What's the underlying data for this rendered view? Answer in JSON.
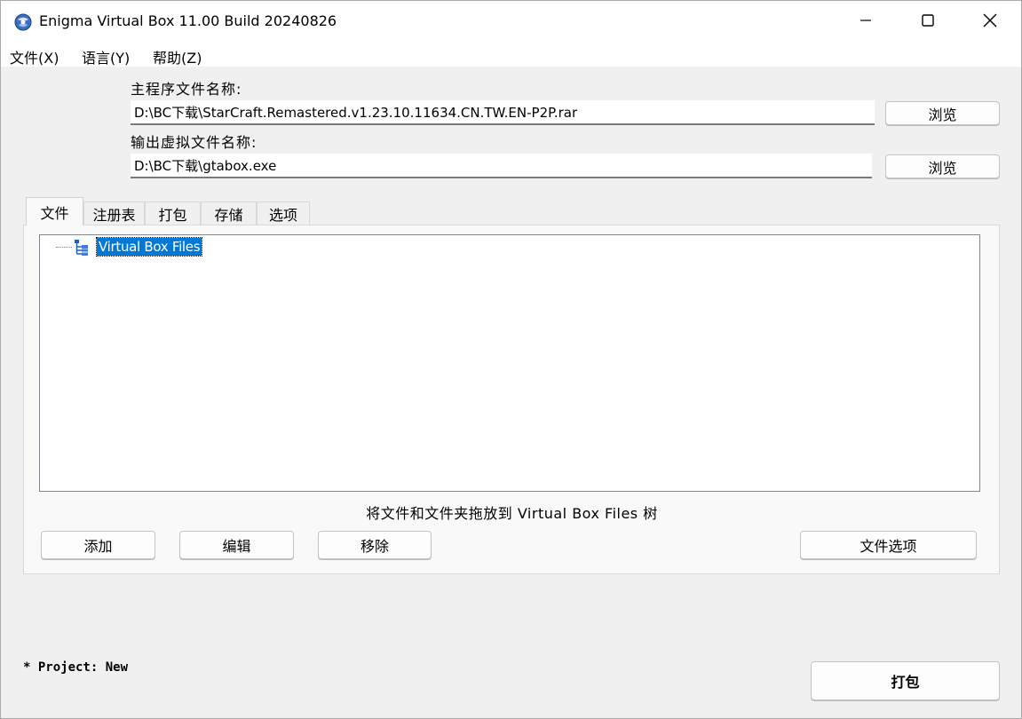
{
  "window": {
    "title": "Enigma Virtual Box 11.00 Build 20240826",
    "controls": [
      "minimize-icon",
      "maximize-icon",
      "close-icon"
    ]
  },
  "menu": {
    "items": [
      "文件(X)",
      "语言(Y)",
      "帮助(Z)"
    ]
  },
  "main_file": {
    "label": "主程序文件名称:",
    "value": "D:\\BC下载\\StarCraft.Remastered.v1.23.10.11634.CN.TW.EN-P2P.rar",
    "browse": "浏览"
  },
  "output_file": {
    "label": "输出虚拟文件名称:",
    "value": "D:\\BC下载\\gtabox.exe",
    "browse": "浏览"
  },
  "tabs": {
    "items": [
      "文件",
      "注册表",
      "打包",
      "存储",
      "选项"
    ],
    "active": "文件"
  },
  "tree": {
    "root_label": "Virtual Box Files",
    "root_icon": "tree-structure-icon"
  },
  "hint": "将文件和文件夹拖放到 Virtual Box Files 树",
  "actions": {
    "add": "添加",
    "edit": "编辑",
    "remove": "移除",
    "file_options": "文件选项"
  },
  "status": "* Project: New",
  "pack_button": "打包",
  "colors": {
    "selection": "#0078d7",
    "background": "#f0f0f0",
    "titlebar": "#ffffff"
  }
}
